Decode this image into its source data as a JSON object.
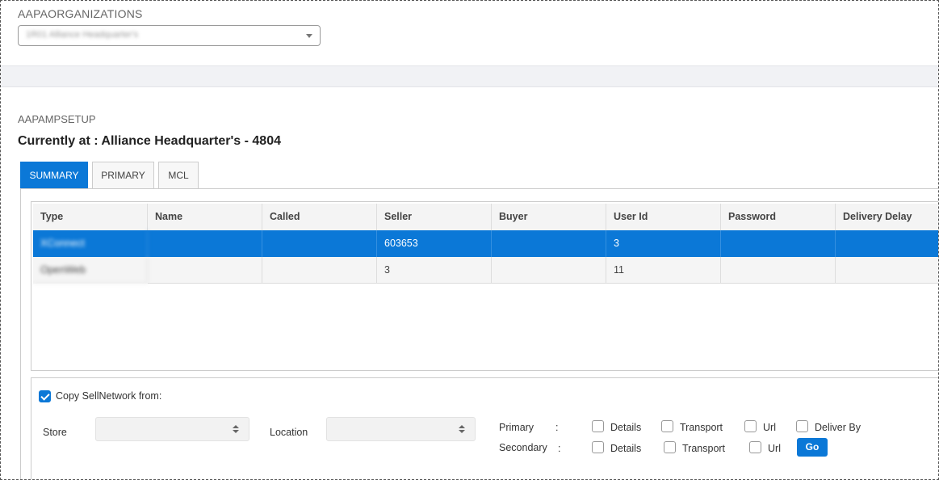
{
  "org": {
    "label": "AAPAORGANIZATIONS",
    "selected": "1R01 Alliance Headquarter's"
  },
  "setup": {
    "label": "AAPAMPSETUP",
    "current": "Currently at : Alliance Headquarter's - 4804"
  },
  "tabs": [
    "SUMMARY",
    "PRIMARY",
    "MCL"
  ],
  "grid": {
    "columns": [
      "Type",
      "Name",
      "Called",
      "Seller",
      "Buyer",
      "User Id",
      "Password",
      "Delivery Delay"
    ],
    "rows": [
      [
        "XConnect",
        "",
        "",
        "603653",
        "",
        "3",
        "",
        ""
      ],
      [
        "OpenWeb",
        "",
        "",
        "3",
        "",
        "11",
        "",
        ""
      ]
    ]
  },
  "copy": {
    "label": "Copy SellNetwork from:",
    "checked": true,
    "store_label": "Store",
    "location_label": "Location",
    "primary_label": "Primary",
    "secondary_label": "Secondary",
    "colon": ":",
    "options": [
      "Details",
      "Transport",
      "Url",
      "Deliver By"
    ],
    "go_label": "Go"
  },
  "colors": {
    "accent": "#0b78d7"
  }
}
